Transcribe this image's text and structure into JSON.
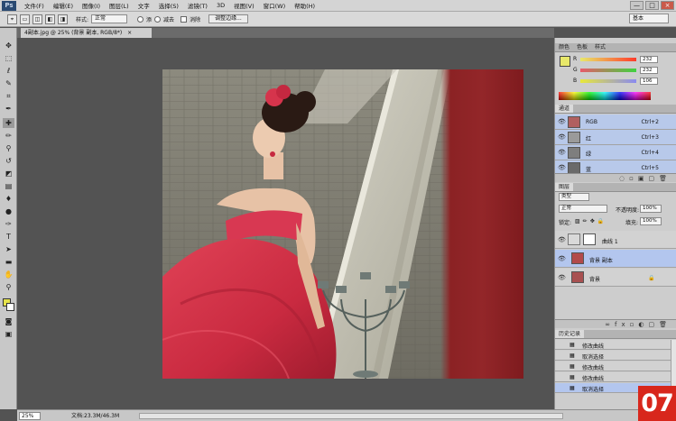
{
  "app": {
    "logo": "Ps",
    "window_controls": [
      "—",
      "□",
      "×"
    ]
  },
  "menu": [
    "文件(F)",
    "编辑(E)",
    "图像(I)",
    "图层(L)",
    "文字",
    "选择(S)",
    "滤镜(T)",
    "3D",
    "视图(V)",
    "窗口(W)",
    "帮助(H)"
  ],
  "options": {
    "style_label": "样式:",
    "style_value": "正常",
    "radio1": "添",
    "radio2": "减去",
    "check": "消除",
    "refine_button": "调整边缘...",
    "workspace": "基本"
  },
  "document": {
    "tab_title": "4副本.jpg @ 25% (背景 副本, RGB/8*)",
    "close": "×"
  },
  "status": {
    "zoom": "25%",
    "doc_size": "文档:23.3M/46.3M"
  },
  "color_panel": {
    "tabs": [
      "颜色",
      "色板",
      "样式"
    ],
    "active": 0,
    "sliders": [
      {
        "label": "R",
        "value": "232",
        "color": "#e84838"
      },
      {
        "label": "G",
        "value": "232",
        "color": "#58b848"
      },
      {
        "label": "B",
        "value": "106",
        "color": "#e8e848"
      }
    ],
    "fg": "#e8e86a"
  },
  "channels_panel": {
    "tabs": [
      "通道"
    ],
    "rows": [
      {
        "name": "RGB",
        "shortcut": "Ctrl+2"
      },
      {
        "name": "红",
        "shortcut": "Ctrl+3"
      },
      {
        "name": "绿",
        "shortcut": "Ctrl+4"
      },
      {
        "name": "蓝",
        "shortcut": "Ctrl+5"
      }
    ]
  },
  "layers_panel": {
    "tabs": [
      "图层"
    ],
    "kind": "类型",
    "blend": "正常",
    "opacity_label": "不透明度:",
    "opacity": "100%",
    "lock_label": "锁定:",
    "fill_label": "填充:",
    "fill": "100%",
    "layers": [
      {
        "name": "曲线 1",
        "selected": false
      },
      {
        "name": "背景 副本",
        "selected": true
      },
      {
        "name": "背景",
        "selected": false
      }
    ]
  },
  "history_panel": {
    "tabs": [
      "历史记录"
    ],
    "rows": [
      "修改曲线",
      "取消选择",
      "修改曲线",
      "修改曲线",
      "取消选择"
    ],
    "selected_index": 4
  },
  "step_badge": "07"
}
